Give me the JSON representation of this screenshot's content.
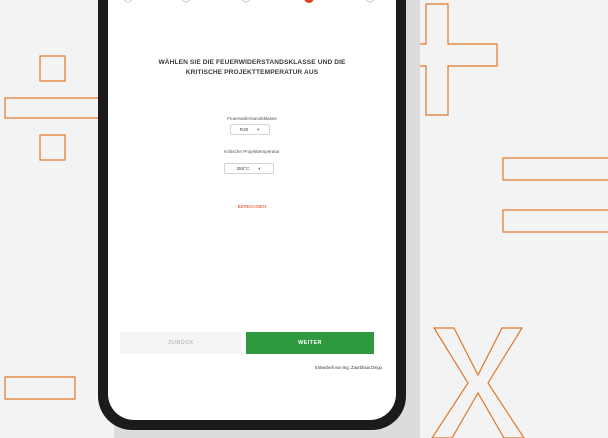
{
  "screen": {
    "heading_line1": "WÄHLEN SIE DIE FEUERWIDERSTANDSKLASSE UND DIE",
    "heading_line2": "KRITISCHE PROJEKTTEMPERATUR AUS",
    "fire_class": {
      "label": "Feuerwiderstandsklasse",
      "value": "R30",
      "chevron_icon": "chevron-down-icon"
    },
    "critical_temp": {
      "label": "Kritische Projekttemperatur",
      "value": "350°C",
      "chevron_icon": "chevron-down-icon"
    },
    "calculate_link": "BERECHNEN",
    "back_button": "ZURÜCK",
    "next_button": "WEITER",
    "credit": "Entwickelt von Ing. Zaurbhaia Dingo"
  },
  "stepper": {
    "steps": 5,
    "active_step": 4
  },
  "colors": {
    "accent_green": "#2e9a3f",
    "accent_red": "#d9431e",
    "decoration_orange": "#e0772b",
    "background": "#f3f3f3",
    "phone_frame": "#1b1b1b"
  }
}
